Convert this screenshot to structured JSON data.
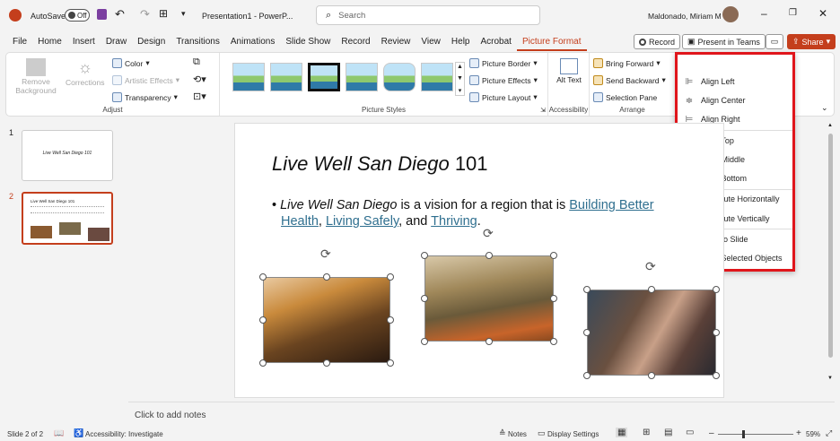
{
  "titlebar": {
    "autosave": "AutoSave",
    "autosave_state": "Off",
    "doc_title": "Presentation1 - PowerP...",
    "search_placeholder": "Search",
    "user": "Maldonado, Miriam M"
  },
  "tabs": [
    "File",
    "Home",
    "Insert",
    "Draw",
    "Design",
    "Transitions",
    "Animations",
    "Slide Show",
    "Record",
    "Review",
    "View",
    "Help",
    "Acrobat",
    "Picture Format"
  ],
  "actions": {
    "record": "Record",
    "present": "Present in Teams",
    "share": "Share"
  },
  "ribbon": {
    "adjust": {
      "remove_bg": "Remove Background",
      "corrections": "Corrections",
      "color": "Color",
      "artistic": "Artistic Effects",
      "transparency": "Transparency",
      "label": "Adjust"
    },
    "styles": {
      "label": "Picture Styles",
      "border": "Picture Border",
      "effects": "Picture Effects",
      "layout": "Picture Layout"
    },
    "accessibility": {
      "alt": "Alt Text",
      "label": "Accessibility"
    },
    "arrange": {
      "forward": "Bring Forward",
      "backward": "Send Backward",
      "pane": "Selection Pane",
      "label": "Arrange"
    }
  },
  "align_menu": [
    "Align Left",
    "Align Center",
    "Align Right",
    "Align Top",
    "Align Middle",
    "Align Bottom",
    "Distribute Horizontally",
    "Distribute Vertically",
    "Align to Slide",
    "Align Selected Objects"
  ],
  "slides": {
    "s1_num": "1",
    "s2_num": "2",
    "s1_title": "Live Well San Diego 101",
    "s2_title": "Live Well San Diego 101"
  },
  "slide": {
    "title_italic": "Live Well San Diego",
    "title_rest": " 101",
    "b_italic": "Live Well San Diego",
    "b_mid": " is a vision for a region that is ",
    "link1": "Building Better Health",
    "comma1": ", ",
    "link2": "Living Safely",
    "and": ", and ",
    "link3": "Thriving",
    "end": "."
  },
  "notes": "Click to add notes",
  "status": {
    "slide": "Slide 2 of 2",
    "acc": "Accessibility: Investigate",
    "notes": "Notes",
    "display": "Display Settings",
    "zoom": "59%"
  }
}
